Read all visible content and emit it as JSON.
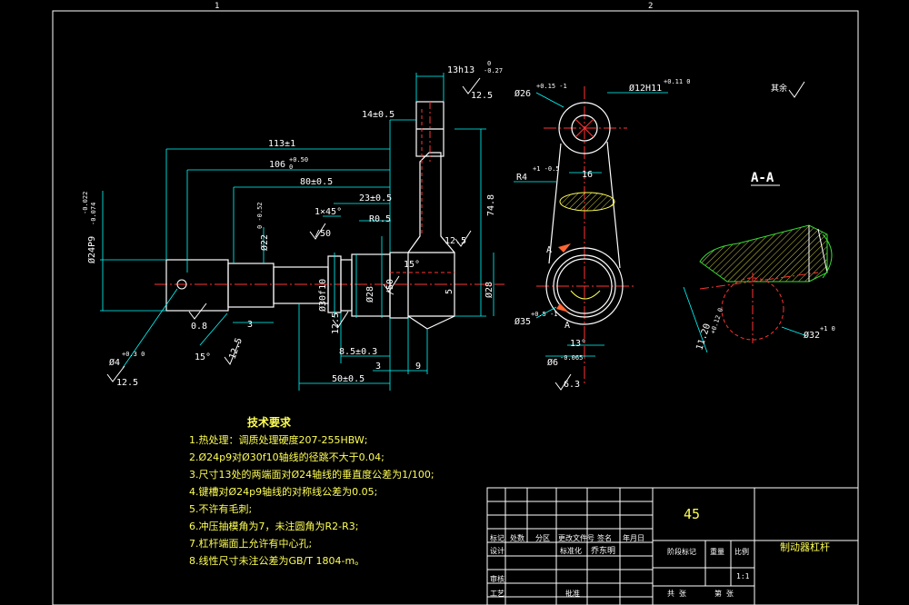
{
  "zones": {
    "left": "1",
    "right": "2"
  },
  "dims": {
    "d113": "113±1",
    "d106": "106",
    "d106_tol_up": "+0.50",
    "d106_tol_lo": "0",
    "d80": "80±0.5",
    "d23": "23±0.5",
    "d14": "14±0.5",
    "d13h13": "13h13",
    "d13h13_tol_up": "0",
    "d13h13_tol_lo": "-0.27",
    "d74": "74.8",
    "d1x45": "1×45°",
    "dR05": "R0.5",
    "d24p9": "Ø24P9",
    "d24p9_tol_up": "-0.022",
    "d24p9_tol_lo": "-0.074",
    "d22": "Ø22",
    "d22_tol": "0 -0.52",
    "d30f10": "Ø30f10",
    "d28": "Ø28",
    "d28b": "Ø28",
    "d8": "0.8",
    "d3": "3",
    "d15a": "15°",
    "d15b": "15°",
    "d85": "8.5±0.3",
    "d3b": "3",
    "d9": "9",
    "d50": "50±0.5",
    "d5": "5",
    "d4": "Ø4",
    "d4_tol": "+0.3 0",
    "d26": "Ø26",
    "d26_tol": "+0.15 -1",
    "d12h11": "Ø12H11",
    "d12h11_tol": "+0.11 0",
    "d16": "16",
    "dR4": "R4",
    "dR4_tol": "+1 -0.5",
    "d35": "Ø35",
    "d35_tol": "+0.5 -1",
    "d13deg": "13°",
    "d6": "Ø6",
    "d6_tol": "-0.065",
    "d11": "11.20",
    "d11_tol": "+0.12 0",
    "d32": "Ø32",
    "d32_tol": "+1 0"
  },
  "roughness": {
    "r125a": "12.5",
    "r125b": "12.5",
    "r125c": "12.5",
    "r125d": "12.5",
    "r125e": "12.5",
    "r08": "0.8",
    "r50a": "/50",
    "r50b": "/50",
    "r63": "6.3",
    "r_rest": "其余"
  },
  "section": {
    "label": "A-A",
    "arrow_a1": "A",
    "arrow_a2": "A"
  },
  "tech_requirements": {
    "title": "技术要求",
    "items": [
      "1.热处理：调质处理硬度207-255HBW;",
      "2.Ø24p9对Ø30f10轴线的径跳不大于0.04;",
      "3.尺寸13处的两端面对Ø24轴线的垂直度公差为1/100;",
      "4.键槽对Ø24p9轴线的对称线公差为0.05;",
      "5.不许有毛刺;",
      "6.冲压抽模角为7，未注圆角为R2-R3;",
      "7.杠杆端面上允许有中心孔;",
      "8.线性尺寸未注公差为GB/T 1804-m。"
    ]
  },
  "title_block": {
    "material": "45",
    "part_name": "制动器杠杆",
    "row_labels": [
      "标记",
      "处数",
      "分区",
      "更改文件号",
      "签名",
      "年月日"
    ],
    "designer_label": "设计",
    "std_label": "标准化",
    "designer_name": "乔东明",
    "stage_label": "阶段标记",
    "weight_label": "重量",
    "scale_label": "比例",
    "scale": "1:1",
    "review_label": "审核",
    "process_label": "工艺",
    "approve_label": "批准",
    "sheets_label": "共 张",
    "sheet_label": "第 张"
  },
  "colors": {
    "outline": "#ffffff",
    "center": "#ff3333",
    "dim": "#00ffff",
    "text": "#ffff55",
    "hatch": "#ffff55",
    "green": "#33dd33"
  }
}
